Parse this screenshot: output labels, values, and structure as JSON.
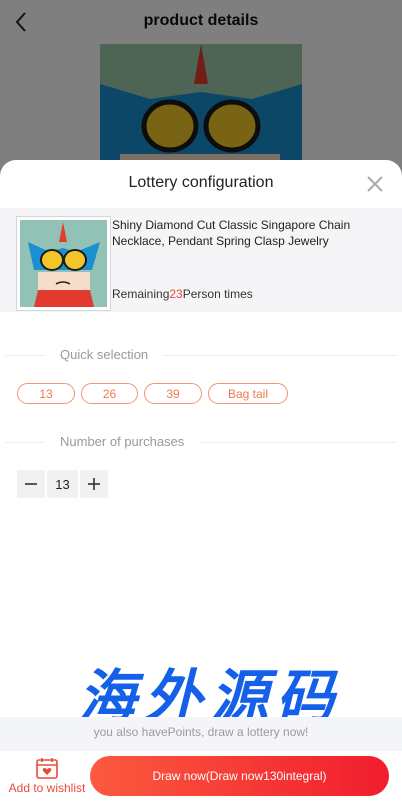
{
  "page": {
    "title": "product details"
  },
  "sheet": {
    "title": "Lottery configuration",
    "product": {
      "name": "Shiny Diamond Cut Classic Singapore Chain Necklace, Pendant Spring Clasp Jewelry",
      "remaining_prefix": "Remaining",
      "remaining_count": "23",
      "remaining_suffix": "Person times"
    },
    "quick_selection": {
      "label": "Quick selection",
      "options": [
        "13",
        "26",
        "39",
        "Bag tail"
      ]
    },
    "purchases": {
      "label": "Number of purchases",
      "value": "13"
    }
  },
  "watermark": "海外源码",
  "points_hint": "you also havePoints, draw a lottery now!",
  "bottom": {
    "wishlist_label": "Add to wishlist",
    "draw_button": "Draw now(Draw now130integral)"
  },
  "colors": {
    "accent": "#f07a4e",
    "primary_gradient_start": "#fb5a3e",
    "primary_gradient_end": "#f11d2e",
    "remaining_highlight": "#e8473b",
    "watermark": "#1560e8"
  }
}
